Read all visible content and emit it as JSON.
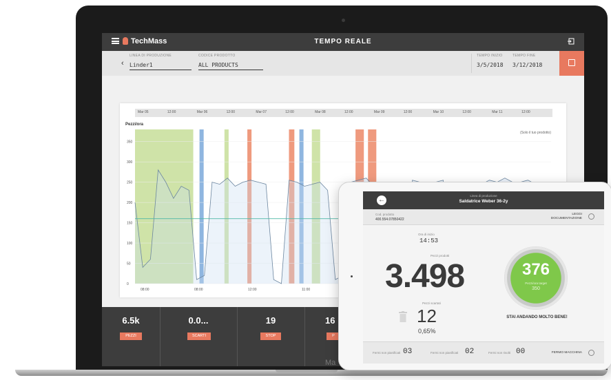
{
  "app": {
    "logo_text": "TechMass",
    "title": "TEMPO REALE"
  },
  "filters": {
    "line_label": "LINEA DI PRODUZIONE",
    "line_value": "Linder1",
    "product_label": "CODICE PRODOTTO",
    "product_value": "ALL PRODUCTS",
    "start_label": "TEMPO INIZIO",
    "start_value": "3/5/2018",
    "end_label": "TEMPO FINE",
    "end_value": "3/12/2018"
  },
  "chart_data": {
    "type": "area",
    "ylabel": "Pezzi/ora",
    "legend_note": "(Solo il tuo prodotto)",
    "timeline_labels": [
      "Mar 05",
      "12:00",
      "Mar 06",
      "12:00",
      "Mar 07",
      "12:00",
      "Mar 08",
      "12:00",
      "Mar 09",
      "12:00",
      "Mar 10",
      "12:00",
      "Mar 11",
      "12:00"
    ],
    "y_ticks": [
      0,
      50,
      100,
      150,
      200,
      250,
      300,
      350
    ],
    "x_ticks": [
      "08:00",
      "08:00",
      "12:00",
      "11:00"
    ],
    "ylim": [
      0,
      380
    ],
    "target_line": 160,
    "status_bands": [
      {
        "start": 0.0,
        "end": 0.14,
        "color": "#cfe3a8"
      },
      {
        "start": 0.155,
        "end": 0.165,
        "color": "#8fb6e0"
      },
      {
        "start": 0.215,
        "end": 0.225,
        "color": "#cfe3a8"
      },
      {
        "start": 0.27,
        "end": 0.28,
        "color": "#ef9a7e"
      },
      {
        "start": 0.37,
        "end": 0.383,
        "color": "#ef9a7e"
      },
      {
        "start": 0.395,
        "end": 0.405,
        "color": "#8fb6e0"
      },
      {
        "start": 0.425,
        "end": 0.445,
        "color": "#cfe3a8"
      },
      {
        "start": 0.53,
        "end": 0.55,
        "color": "#ef9a7e"
      },
      {
        "start": 0.56,
        "end": 0.58,
        "color": "#ef9a7e"
      }
    ],
    "series": [
      {
        "values": [
          200,
          40,
          60,
          280,
          250,
          210,
          240,
          230,
          10,
          20,
          250,
          245,
          260,
          240,
          250,
          255,
          250,
          245,
          10,
          0,
          255,
          250,
          240,
          245,
          250,
          230,
          10,
          20,
          250,
          255,
          260,
          240,
          250,
          245,
          0,
          0,
          255,
          250,
          240,
          250,
          255,
          30,
          20,
          250,
          240,
          245,
          255,
          250,
          260,
          250,
          250,
          255,
          245,
          250,
          240
        ]
      }
    ]
  },
  "stats": [
    {
      "value": "6.5k",
      "label": "PEZZI"
    },
    {
      "value": "0.0...",
      "label": "SCARTI"
    },
    {
      "value": "19",
      "label": "STOP"
    },
    {
      "value": "16",
      "label": "P"
    }
  ],
  "laptop_brand": "Ma",
  "tablet": {
    "line_label": "Linea di produzione",
    "line_name": "Saldatrice Weber 36-2y",
    "code_label": "Cod. prodotto",
    "code_value": "400.554.07850422",
    "docs_label_1": "LEGGI",
    "docs_label_2": "DOCUMENTAZIONE",
    "time_label": "Ora di inizio",
    "time_value": "14:53",
    "produced_label": "Pezzi prodotti",
    "produced_value": "3.498",
    "scrap_label": "Pezzi scartati",
    "scrap_value": "12",
    "scrap_percent": "0,65%",
    "gauge_value": "376",
    "gauge_sub": "Pezzi/ora target",
    "gauge_target": "350",
    "message": "STAI ANDANDO MOLTO BENE!",
    "footer": {
      "stop_pianificati_label": "Fermi non pianificati",
      "stop_pianificati_value": "03",
      "stop_non_pian_label": "Fermi non pianificati",
      "stop_non_pian_value": "02",
      "stop_label": "Fermi non risolti",
      "stop_value": "00",
      "fermo_label": "FERMO MACCHINA"
    }
  },
  "colors": {
    "accent": "#e8795f",
    "header": "#3d3d3d",
    "good": "#7fc84a"
  }
}
